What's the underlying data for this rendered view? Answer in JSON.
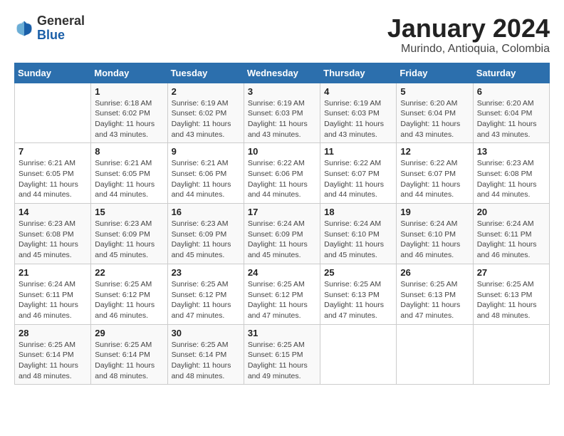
{
  "header": {
    "logo_general": "General",
    "logo_blue": "Blue",
    "month_year": "January 2024",
    "location": "Murindo, Antioquia, Colombia"
  },
  "weekdays": [
    "Sunday",
    "Monday",
    "Tuesday",
    "Wednesday",
    "Thursday",
    "Friday",
    "Saturday"
  ],
  "weeks": [
    [
      {
        "day": "",
        "info": ""
      },
      {
        "day": "1",
        "info": "Sunrise: 6:18 AM\nSunset: 6:02 PM\nDaylight: 11 hours\nand 43 minutes."
      },
      {
        "day": "2",
        "info": "Sunrise: 6:19 AM\nSunset: 6:02 PM\nDaylight: 11 hours\nand 43 minutes."
      },
      {
        "day": "3",
        "info": "Sunrise: 6:19 AM\nSunset: 6:03 PM\nDaylight: 11 hours\nand 43 minutes."
      },
      {
        "day": "4",
        "info": "Sunrise: 6:19 AM\nSunset: 6:03 PM\nDaylight: 11 hours\nand 43 minutes."
      },
      {
        "day": "5",
        "info": "Sunrise: 6:20 AM\nSunset: 6:04 PM\nDaylight: 11 hours\nand 43 minutes."
      },
      {
        "day": "6",
        "info": "Sunrise: 6:20 AM\nSunset: 6:04 PM\nDaylight: 11 hours\nand 43 minutes."
      }
    ],
    [
      {
        "day": "7",
        "info": "Sunrise: 6:21 AM\nSunset: 6:05 PM\nDaylight: 11 hours\nand 44 minutes."
      },
      {
        "day": "8",
        "info": "Sunrise: 6:21 AM\nSunset: 6:05 PM\nDaylight: 11 hours\nand 44 minutes."
      },
      {
        "day": "9",
        "info": "Sunrise: 6:21 AM\nSunset: 6:06 PM\nDaylight: 11 hours\nand 44 minutes."
      },
      {
        "day": "10",
        "info": "Sunrise: 6:22 AM\nSunset: 6:06 PM\nDaylight: 11 hours\nand 44 minutes."
      },
      {
        "day": "11",
        "info": "Sunrise: 6:22 AM\nSunset: 6:07 PM\nDaylight: 11 hours\nand 44 minutes."
      },
      {
        "day": "12",
        "info": "Sunrise: 6:22 AM\nSunset: 6:07 PM\nDaylight: 11 hours\nand 44 minutes."
      },
      {
        "day": "13",
        "info": "Sunrise: 6:23 AM\nSunset: 6:08 PM\nDaylight: 11 hours\nand 44 minutes."
      }
    ],
    [
      {
        "day": "14",
        "info": "Sunrise: 6:23 AM\nSunset: 6:08 PM\nDaylight: 11 hours\nand 45 minutes."
      },
      {
        "day": "15",
        "info": "Sunrise: 6:23 AM\nSunset: 6:09 PM\nDaylight: 11 hours\nand 45 minutes."
      },
      {
        "day": "16",
        "info": "Sunrise: 6:23 AM\nSunset: 6:09 PM\nDaylight: 11 hours\nand 45 minutes."
      },
      {
        "day": "17",
        "info": "Sunrise: 6:24 AM\nSunset: 6:09 PM\nDaylight: 11 hours\nand 45 minutes."
      },
      {
        "day": "18",
        "info": "Sunrise: 6:24 AM\nSunset: 6:10 PM\nDaylight: 11 hours\nand 45 minutes."
      },
      {
        "day": "19",
        "info": "Sunrise: 6:24 AM\nSunset: 6:10 PM\nDaylight: 11 hours\nand 46 minutes."
      },
      {
        "day": "20",
        "info": "Sunrise: 6:24 AM\nSunset: 6:11 PM\nDaylight: 11 hours\nand 46 minutes."
      }
    ],
    [
      {
        "day": "21",
        "info": "Sunrise: 6:24 AM\nSunset: 6:11 PM\nDaylight: 11 hours\nand 46 minutes."
      },
      {
        "day": "22",
        "info": "Sunrise: 6:25 AM\nSunset: 6:12 PM\nDaylight: 11 hours\nand 46 minutes."
      },
      {
        "day": "23",
        "info": "Sunrise: 6:25 AM\nSunset: 6:12 PM\nDaylight: 11 hours\nand 47 minutes."
      },
      {
        "day": "24",
        "info": "Sunrise: 6:25 AM\nSunset: 6:12 PM\nDaylight: 11 hours\nand 47 minutes."
      },
      {
        "day": "25",
        "info": "Sunrise: 6:25 AM\nSunset: 6:13 PM\nDaylight: 11 hours\nand 47 minutes."
      },
      {
        "day": "26",
        "info": "Sunrise: 6:25 AM\nSunset: 6:13 PM\nDaylight: 11 hours\nand 47 minutes."
      },
      {
        "day": "27",
        "info": "Sunrise: 6:25 AM\nSunset: 6:13 PM\nDaylight: 11 hours\nand 48 minutes."
      }
    ],
    [
      {
        "day": "28",
        "info": "Sunrise: 6:25 AM\nSunset: 6:14 PM\nDaylight: 11 hours\nand 48 minutes."
      },
      {
        "day": "29",
        "info": "Sunrise: 6:25 AM\nSunset: 6:14 PM\nDaylight: 11 hours\nand 48 minutes."
      },
      {
        "day": "30",
        "info": "Sunrise: 6:25 AM\nSunset: 6:14 PM\nDaylight: 11 hours\nand 48 minutes."
      },
      {
        "day": "31",
        "info": "Sunrise: 6:25 AM\nSunset: 6:15 PM\nDaylight: 11 hours\nand 49 minutes."
      },
      {
        "day": "",
        "info": ""
      },
      {
        "day": "",
        "info": ""
      },
      {
        "day": "",
        "info": ""
      }
    ]
  ]
}
